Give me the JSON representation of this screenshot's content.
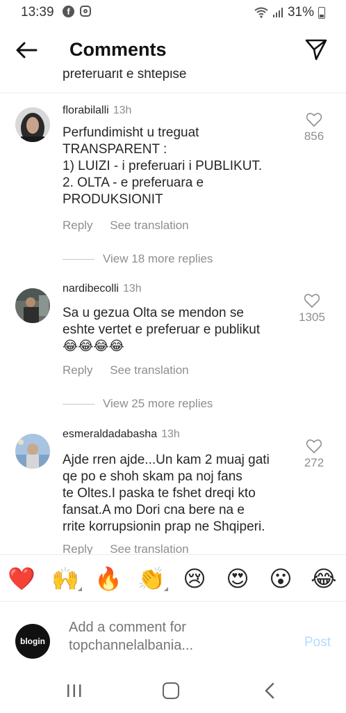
{
  "status_bar": {
    "time": "13:39",
    "battery": "31%",
    "icons": [
      "facebook-icon",
      "instagram-icon",
      "wifi-icon",
      "signal-icon",
      "battery-icon"
    ]
  },
  "header": {
    "title": "Comments",
    "back_icon": "arrow-left-icon",
    "send_icon": "paper-plane-icon"
  },
  "partial_comment_text": "preferuarit e shtepise",
  "comments": [
    {
      "username": "florabilalli",
      "time": "13h",
      "text": "Perfundimisht u treguat\nTRANSPARENT :\n1) LUIZI - i preferuari i PUBLIKUT.\n2. OLTA - e preferuara e\nPRODUKSIONIT",
      "reply_label": "Reply",
      "translate_label": "See translation",
      "likes": "856",
      "view_replies": "View 18 more replies"
    },
    {
      "username": "nardibecolli",
      "time": "13h",
      "text": "Sa u gezua Olta se mendon se\neshte vertet e preferuar e publikut\n😂😂😂😂",
      "reply_label": "Reply",
      "translate_label": "See translation",
      "likes": "1305",
      "view_replies": "View 25 more replies"
    },
    {
      "username": "esmeraldadabasha",
      "time": "13h",
      "text": "Ajde rren ajde...Un kam 2 muaj gati\nqe po e shoh skam pa noj fans\nte Oltes.I paska te fshet dreqi kto\nfansat.A mo Dori cna bere na e\nrrite korrupsionin prap ne Shqiperi.",
      "reply_label": "Reply",
      "translate_label": "See translation",
      "likes": "272"
    }
  ],
  "emoji_bar": [
    "❤️",
    "🙌",
    "🔥",
    "👏",
    "😢",
    "😍",
    "😮",
    "😂"
  ],
  "composer": {
    "avatar_text": "blogin",
    "placeholder": "Add a comment for topchannelalbania...",
    "post_label": "Post"
  },
  "colors": {
    "muted": "#8e8e8e",
    "post_disabled": "#b3dbff",
    "text": "#262626"
  }
}
